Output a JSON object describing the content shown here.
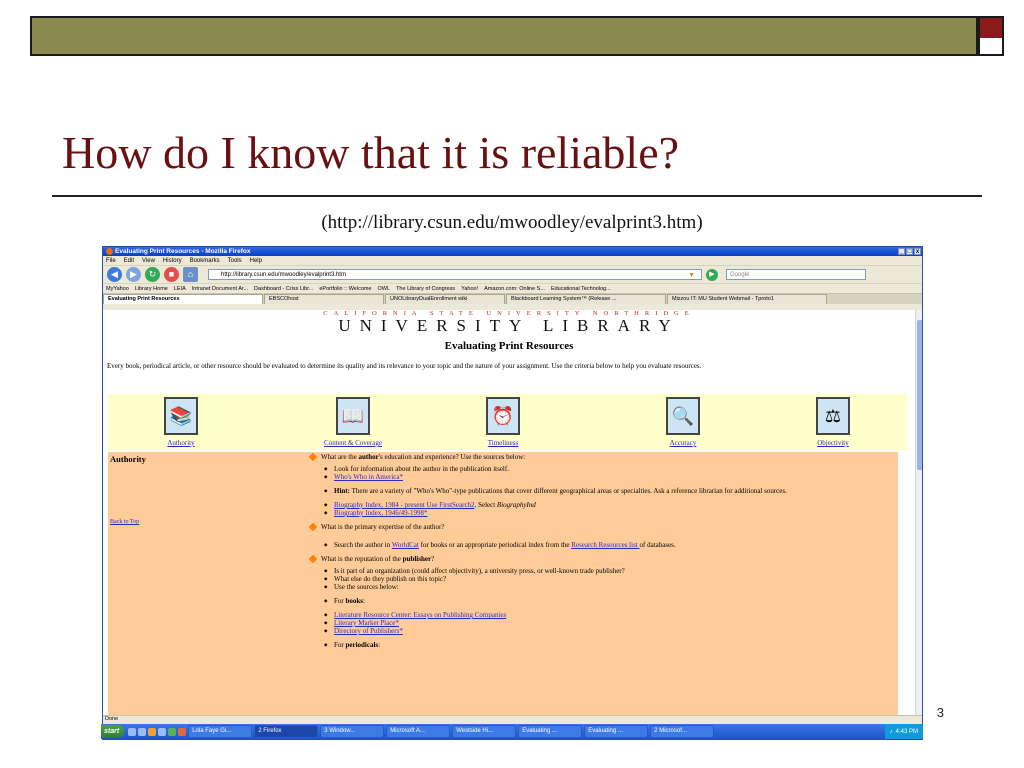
{
  "slide": {
    "title": "How do I know that it is reliable?",
    "url_caption": "(http://library.csun.edu/mwoodley/evalprint3.htm)",
    "page_number": "3"
  },
  "browser": {
    "window_title": "Evaluating Print Resources - Mozilla Firefox",
    "window_buttons": [
      "_",
      "□",
      "x"
    ],
    "menu": [
      "File",
      "Edit",
      "View",
      "History",
      "Bookmarks",
      "Tools",
      "Help"
    ],
    "address": "http://library.csun.edu/mwoodley/evalprint3.htm",
    "search_placeholder": "Google",
    "bookmarks": [
      "MyYahoo",
      "Library Home",
      "LEIA",
      "Intranet Document Ar...",
      "Dashboard - Criss Libr...",
      "ePortfolio :: Welcome",
      "OWL",
      "The Library of Congress",
      "Yahoo!",
      "Amazon.com: Online S...",
      "Educational Technolog..."
    ],
    "tabs": [
      "Evaluating Print Resources",
      "EBSCOhost",
      "UNOLibraryDualEnrollment wiki",
      "Blackboard Learning System™ (Release ...",
      "Mizzou IT: MU Student Webmail - Tproto1"
    ],
    "status": "Done"
  },
  "page": {
    "header_top": "CALIFORNIA STATE UNIVERSITY NORTHRIDGE",
    "header_main": "UNIVERSITY LIBRARY",
    "heading": "Evaluating Print Resources",
    "intro": "Every book, periodical article, or other resource should be evaluated to determine its quality and its relevance to your topic and the nature of your assignment. Use the criteria below to help you evaluate resources.",
    "criteria": [
      "Authority",
      "Content & Coverage",
      "Timeliness",
      "Accuracy",
      "Objectivity"
    ],
    "section_title": "Authority",
    "back_to_top": "Back to Top",
    "q1_pre": "What are the ",
    "q1_bold": "author",
    "q1_post": "'s education and experience? Use the sources below:",
    "b1": "Look for information about the author in the publication itself.",
    "b2": "Who's Who in America*",
    "hint_label": "Hint:",
    "hint_text": " There are a variety of \"Who's Who\"-type publications that cover different geographical areas or specialties. Ask a reference librarian for additional sources.",
    "bio1_link": "Biography Index, 1984 - present Use FirstSearch2",
    "bio1_post": ". Select ",
    "bio1_italic": "BiographyInd",
    "bio2_link": "Biography Index, 1946/49-1998*",
    "q2": "What is the primary expertise of the author?",
    "s_pre": "Search the author in ",
    "s_link1": "WorldCat",
    "s_mid": " for books or an appropriate periodical index from the ",
    "s_link2": "Research Resources list ",
    "s_post": "of databases.",
    "q3_pre": "What is the reputation of the ",
    "q3_bold": "publisher",
    "q3_post": "?",
    "p1": "Is it part of an organization (could affect objectivity), a university press, or well-known trade publisher?",
    "p2": "What else do they publish on this topic?",
    "p3": "Use the sources below:",
    "for_books_pre": "For ",
    "for_books_bold": "books",
    "for_books_post": ":",
    "l1": "Literature Resource Center: Essays on Publishing Companies",
    "l2": "Literary Market Place*",
    "l3": "Directory of Publishers*",
    "for_per_pre": "For ",
    "for_per_bold": "periodicals",
    "for_per_post": ":"
  },
  "taskbar": {
    "start": "start",
    "tasks": [
      "Lola Faye Gi...",
      "2 Firefox",
      "3 Window...",
      "Microsoft A...",
      "Westside Hi...",
      "Evaluating ...",
      "Evaluating ...",
      "2 Microsof..."
    ],
    "clock": "4:43 PM"
  }
}
